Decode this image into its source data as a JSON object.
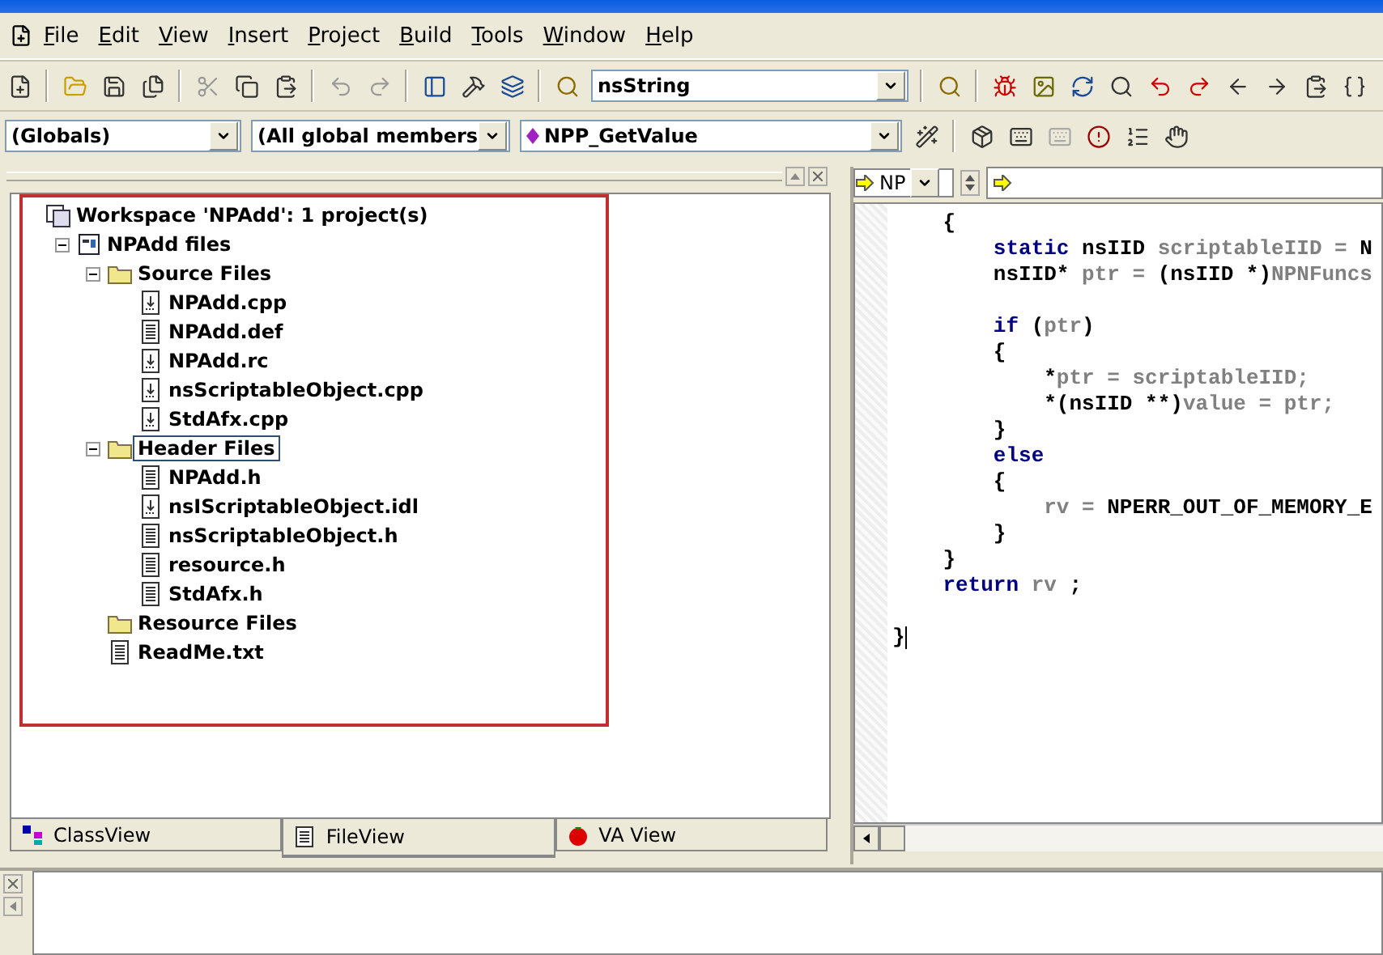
{
  "menu": [
    "File",
    "Edit",
    "View",
    "Insert",
    "Project",
    "Build",
    "Tools",
    "Window",
    "Help"
  ],
  "find_combo": {
    "value": "nsString"
  },
  "wizard_bar": {
    "class_combo": "(Globals)",
    "filter_combo": "(All global members",
    "member_combo": "NPP_GetValue"
  },
  "workspace": {
    "tree": [
      {
        "kind": "workspace",
        "label": "Workspace 'NPAdd': 1 project(s)",
        "selected": false,
        "children": [
          {
            "kind": "project",
            "label": "NPAdd files",
            "selected": false,
            "expanded": true,
            "children": [
              {
                "kind": "folder",
                "label": "Source Files",
                "selected": false,
                "expanded": true,
                "children": [
                  {
                    "kind": "source",
                    "label": "NPAdd.cpp",
                    "selected": false
                  },
                  {
                    "kind": "text",
                    "label": "NPAdd.def",
                    "selected": false
                  },
                  {
                    "kind": "source",
                    "label": "NPAdd.rc",
                    "selected": false
                  },
                  {
                    "kind": "source",
                    "label": "nsScriptableObject.cpp",
                    "selected": false
                  },
                  {
                    "kind": "source",
                    "label": "StdAfx.cpp",
                    "selected": false
                  }
                ]
              },
              {
                "kind": "folder",
                "label": "Header Files",
                "selected": true,
                "expanded": true,
                "children": [
                  {
                    "kind": "text",
                    "label": "NPAdd.h",
                    "selected": false
                  },
                  {
                    "kind": "source",
                    "label": "nsIScriptableObject.idl",
                    "selected": false
                  },
                  {
                    "kind": "text",
                    "label": "nsScriptableObject.h",
                    "selected": false
                  },
                  {
                    "kind": "text",
                    "label": "resource.h",
                    "selected": false
                  },
                  {
                    "kind": "text",
                    "label": "StdAfx.h",
                    "selected": false
                  }
                ]
              },
              {
                "kind": "folder",
                "label": "Resource Files",
                "selected": false
              },
              {
                "kind": "text",
                "label": "ReadMe.txt",
                "selected": false
              }
            ]
          }
        ]
      }
    ],
    "tabs": [
      {
        "kind": "class",
        "label": "ClassView",
        "selected": false
      },
      {
        "kind": "file",
        "label": "FileView",
        "selected": true
      },
      {
        "kind": "va",
        "label": "VA View",
        "selected": false
      }
    ]
  },
  "editor": {
    "selector": "NP",
    "lines": [
      {
        "cursor": false,
        "segments": [
          {
            "kind": "plain",
            "text": "    {"
          }
        ]
      },
      {
        "cursor": false,
        "segments": [
          {
            "kind": "keyword",
            "text": "        static"
          },
          {
            "kind": "plain",
            "text": " nsIID "
          },
          {
            "kind": "ident",
            "text": "scriptableIID = "
          },
          {
            "kind": "plain",
            "text": "N"
          }
        ]
      },
      {
        "cursor": false,
        "segments": [
          {
            "kind": "plain",
            "text": "        nsIID*"
          },
          {
            "kind": "ident",
            "text": " ptr = "
          },
          {
            "kind": "plain",
            "text": "(nsIID *)"
          },
          {
            "kind": "ident",
            "text": "NPNFuncs"
          }
        ]
      },
      {
        "cursor": false
      },
      {
        "cursor": false,
        "segments": [
          {
            "kind": "keyword",
            "text": "        if"
          },
          {
            "kind": "plain",
            "text": " ("
          },
          {
            "kind": "ident",
            "text": "ptr"
          },
          {
            "kind": "plain",
            "text": ")"
          }
        ]
      },
      {
        "cursor": false,
        "segments": [
          {
            "kind": "plain",
            "text": "        {"
          }
        ]
      },
      {
        "cursor": false,
        "segments": [
          {
            "kind": "plain",
            "text": "            *"
          },
          {
            "kind": "ident",
            "text": "ptr = scriptableIID;"
          }
        ]
      },
      {
        "cursor": false,
        "segments": [
          {
            "kind": "plain",
            "text": "            *(nsIID **)"
          },
          {
            "kind": "ident",
            "text": "value = ptr;"
          }
        ]
      },
      {
        "cursor": false,
        "segments": [
          {
            "kind": "plain",
            "text": "        }"
          }
        ]
      },
      {
        "cursor": false,
        "segments": [
          {
            "kind": "keyword",
            "text": "        else"
          }
        ]
      },
      {
        "cursor": false,
        "segments": [
          {
            "kind": "plain",
            "text": "        {"
          }
        ]
      },
      {
        "cursor": false,
        "segments": [
          {
            "kind": "ident",
            "text": "            rv = "
          },
          {
            "kind": "plain",
            "text": "NPERR_OUT_OF_MEMORY_E"
          }
        ]
      },
      {
        "cursor": false,
        "segments": [
          {
            "kind": "plain",
            "text": "        }"
          }
        ]
      },
      {
        "cursor": false,
        "segments": [
          {
            "kind": "plain",
            "text": "    }"
          }
        ]
      },
      {
        "cursor": false,
        "segments": [
          {
            "kind": "keyword",
            "text": "    return"
          },
          {
            "kind": "ident",
            "text": " rv "
          },
          {
            "kind": "plain",
            "text": ";"
          }
        ]
      },
      {
        "cursor": false
      },
      {
        "cursor": true,
        "segments": [
          {
            "kind": "plain",
            "text": "}"
          }
        ]
      }
    ]
  }
}
